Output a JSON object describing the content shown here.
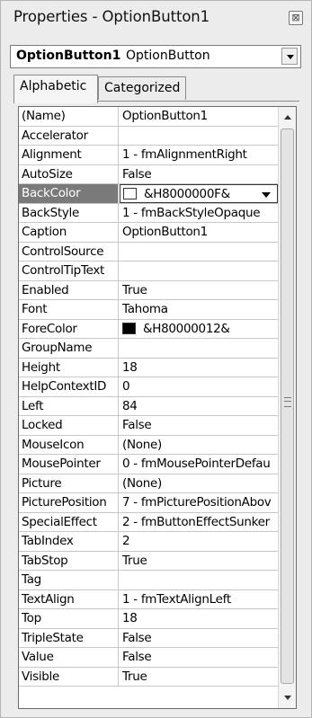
{
  "window": {
    "title": "Properties - OptionButton1",
    "close_glyph": "⊠"
  },
  "object_selector": {
    "name": "OptionButton1",
    "type": "OptionButton"
  },
  "tabs": [
    {
      "label": "Alphabetic",
      "active": true
    },
    {
      "label": "Categorized",
      "active": false
    }
  ],
  "properties": [
    {
      "name": "(Name)",
      "value": "OptionButton1"
    },
    {
      "name": "Accelerator",
      "value": ""
    },
    {
      "name": "Alignment",
      "value": "1 - fmAlignmentRight"
    },
    {
      "name": "AutoSize",
      "value": "False"
    },
    {
      "name": "BackColor",
      "value": "&H8000000F&",
      "swatch": "#ffffff",
      "selected": true
    },
    {
      "name": "BackStyle",
      "value": "1 - fmBackStyleOpaque"
    },
    {
      "name": "Caption",
      "value": "OptionButton1"
    },
    {
      "name": "ControlSource",
      "value": ""
    },
    {
      "name": "ControlTipText",
      "value": ""
    },
    {
      "name": "Enabled",
      "value": "True"
    },
    {
      "name": "Font",
      "value": "Tahoma"
    },
    {
      "name": "ForeColor",
      "value": "&H80000012&",
      "swatch": "#000000"
    },
    {
      "name": "GroupName",
      "value": ""
    },
    {
      "name": "Height",
      "value": "18"
    },
    {
      "name": "HelpContextID",
      "value": "0"
    },
    {
      "name": "Left",
      "value": "84"
    },
    {
      "name": "Locked",
      "value": "False"
    },
    {
      "name": "MouseIcon",
      "value": "(None)"
    },
    {
      "name": "MousePointer",
      "value": "0 - fmMousePointerDefau"
    },
    {
      "name": "Picture",
      "value": "(None)"
    },
    {
      "name": "PicturePosition",
      "value": "7 - fmPicturePositionAbov"
    },
    {
      "name": "SpecialEffect",
      "value": "2 - fmButtonEffectSunker"
    },
    {
      "name": "TabIndex",
      "value": "2"
    },
    {
      "name": "TabStop",
      "value": "True"
    },
    {
      "name": "Tag",
      "value": ""
    },
    {
      "name": "TextAlign",
      "value": "1 - fmTextAlignLeft"
    },
    {
      "name": "Top",
      "value": "18"
    },
    {
      "name": "TripleState",
      "value": "False"
    },
    {
      "name": "Value",
      "value": "False"
    },
    {
      "name": "Visible",
      "value": "True"
    }
  ]
}
